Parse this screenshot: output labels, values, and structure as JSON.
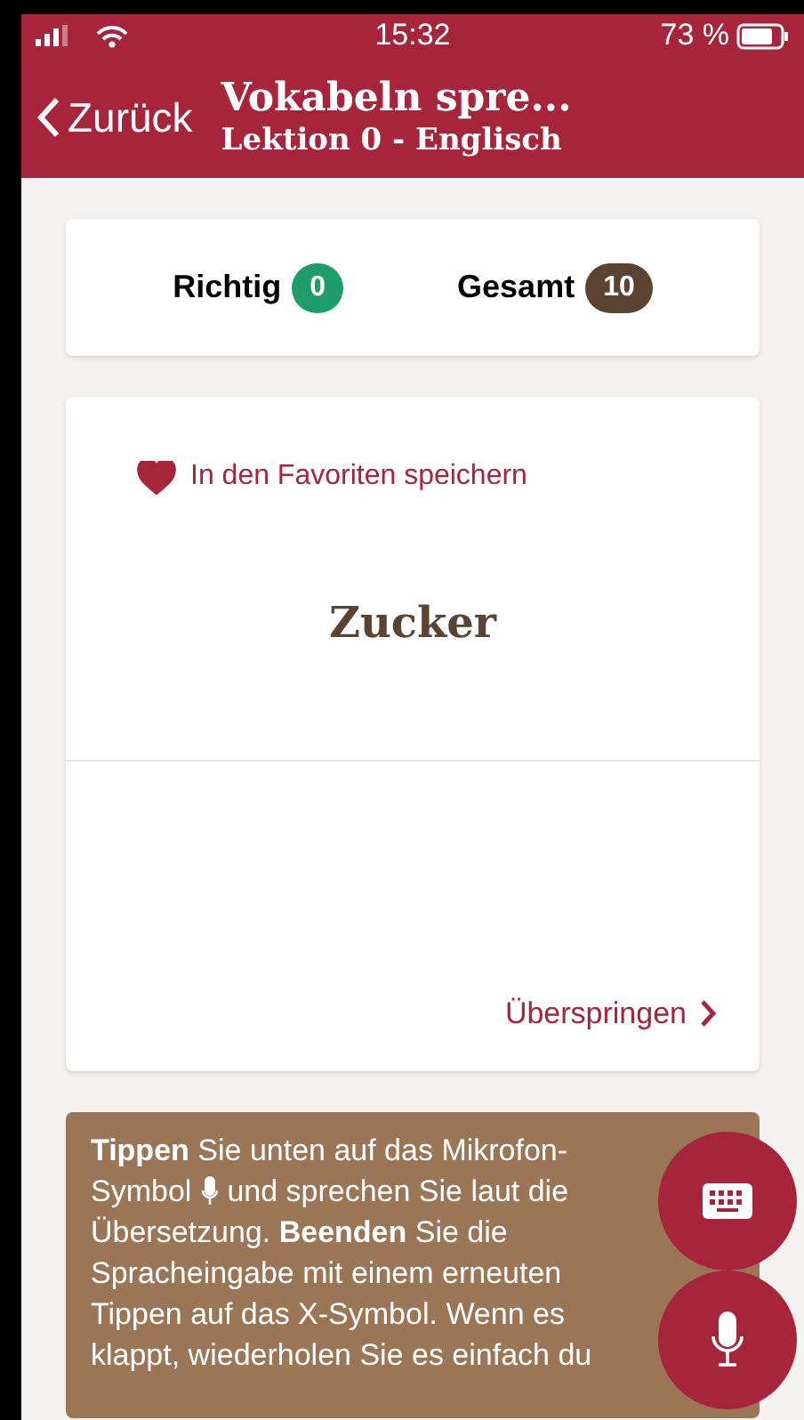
{
  "status_bar": {
    "time": "15:32",
    "battery": "73 %"
  },
  "header": {
    "back": "Zurück",
    "title": "Vokabeln spre...",
    "subtitle": "Lektion 0 - Englisch"
  },
  "score": [
    {
      "label": "Richtig",
      "count": "0",
      "color": "#1f9d68"
    },
    {
      "label": "Gesamt",
      "count": "10",
      "color": "#5a4331"
    }
  ],
  "card": {
    "favorite": {
      "label": "In den Favoriten speichern",
      "on": true
    },
    "word": "Zucker",
    "skip": "Überspringen"
  },
  "hint": {
    "parts": [
      "**Tippen** Sie unten auf das Mikrofon-",
      "Symbol",
      "und sprechen Sie laut die",
      "Übersetzung. **Beenden** Sie die Spracheingabe mit einem erneuten Tippen auf das X-Symbol. Wenn es klappt, wiederholen Sie es einfach du"
    ]
  }
}
